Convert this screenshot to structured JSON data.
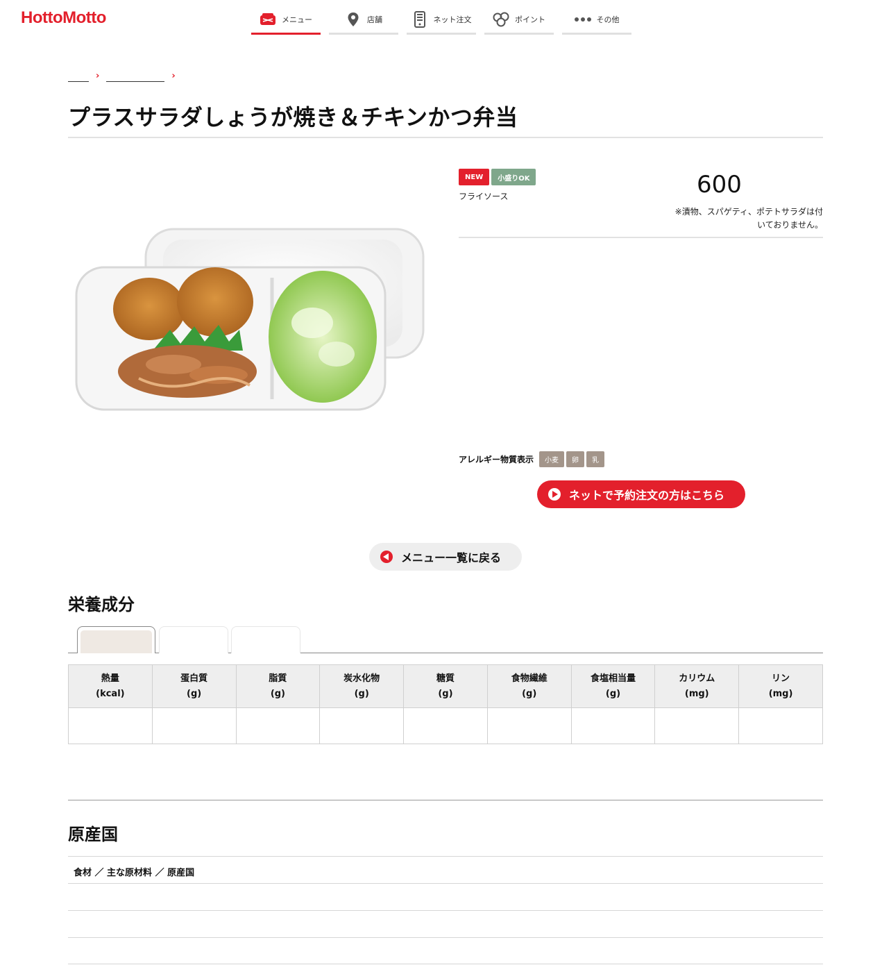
{
  "header": {
    "logo": "HottoMotto",
    "nav": [
      {
        "label": "メニュー",
        "icon": "bento-icon"
      },
      {
        "label": "店舗",
        "icon": "map-pin-icon"
      },
      {
        "label": "ネット注文",
        "icon": "phone-icon"
      },
      {
        "label": "ポイント",
        "icon": "coins-icon"
      },
      {
        "label": "その他",
        "icon": "more-dots-icon"
      }
    ],
    "active_nav": "メニュー"
  },
  "breadcrumb": {
    "items": [
      "",
      ""
    ],
    "separator": "›"
  },
  "product": {
    "title": "プラスサラダしょうが焼き＆チキンかつ弁当",
    "badges": [
      "NEW",
      "小盛りOK"
    ],
    "sauce": "フライソース",
    "price": "600",
    "note": "※漬物、スパゲティ、ポテトサラダは付いておりません。",
    "allergy_label": "アレルギー物質表示",
    "allergens": [
      "小麦",
      "卵",
      "乳"
    ],
    "order_button": "ネットで予約注文の方はこちら",
    "back_button": "メニュー一覧に戻る"
  },
  "nutrition": {
    "title": "栄養成分",
    "tabs": [
      "",
      "",
      ""
    ],
    "columns": [
      {
        "name": "熱量",
        "unit": "(kcal)"
      },
      {
        "name": "蛋白質",
        "unit": "(g)"
      },
      {
        "name": "脂質",
        "unit": "(g)"
      },
      {
        "name": "炭水化物",
        "unit": "(g)"
      },
      {
        "name": "糖質",
        "unit": "(g)"
      },
      {
        "name": "食物繊維",
        "unit": "(g)"
      },
      {
        "name": "食塩相当量",
        "unit": "(g)"
      },
      {
        "name": "カリウム",
        "unit": "(mg)"
      },
      {
        "name": "リン",
        "unit": "(mg)"
      }
    ],
    "values": [
      "",
      "",
      "",
      "",
      "",
      "",
      "",
      "",
      ""
    ]
  },
  "origin": {
    "title": "原産国",
    "header": "食材 ／ 主な原材料 ／ 原産国",
    "rows": [
      "",
      "",
      ""
    ]
  },
  "colors": {
    "brand": "#e3202c",
    "badge_green": "#7fa78b",
    "allergen": "#a3958a"
  }
}
